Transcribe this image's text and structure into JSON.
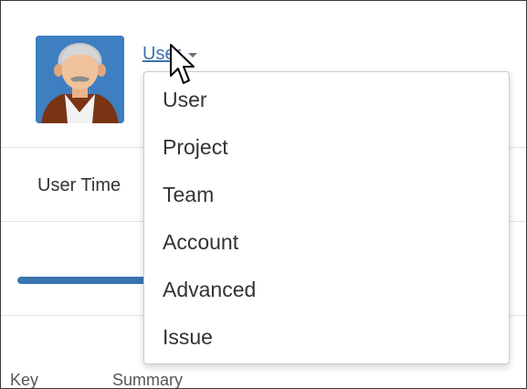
{
  "header": {
    "type_selector_label": "User"
  },
  "tabs": {
    "active_label": "User Time"
  },
  "progress": {
    "fraction": 0.42,
    "color": "#3b73af"
  },
  "table": {
    "columns": [
      "Key",
      "Summary"
    ]
  },
  "dropdown": {
    "items": [
      {
        "label": "User"
      },
      {
        "label": "Project"
      },
      {
        "label": "Team"
      },
      {
        "label": "Account"
      },
      {
        "label": "Advanced"
      },
      {
        "label": "Issue"
      }
    ]
  },
  "colors": {
    "link": "#3b73af",
    "avatar_bg": "#3d7fc1"
  },
  "icons": {
    "avatar": "user-avatar-icon",
    "caret": "chevron-down-icon",
    "pointer": "mouse-pointer-icon"
  }
}
